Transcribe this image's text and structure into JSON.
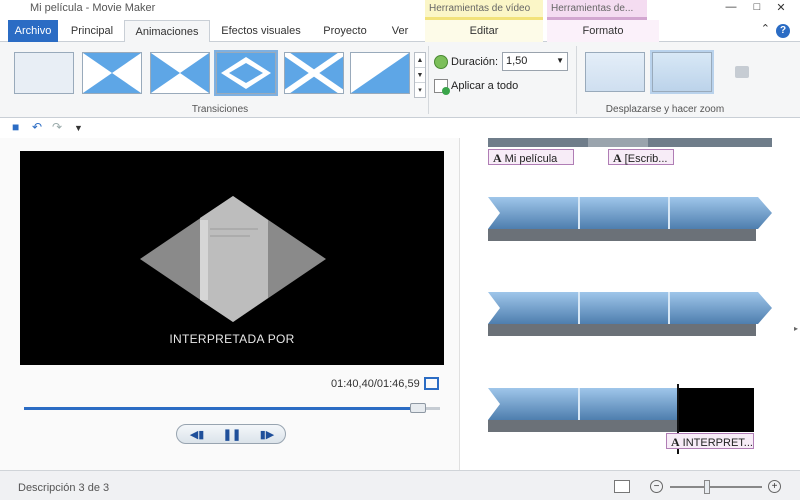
{
  "window": {
    "title": "Mi película - Movie Maker",
    "context_tabs": {
      "video_tools": "Herramientas de vídeo",
      "text_tools": "Herramientas de..."
    },
    "controls": [
      "—",
      "□",
      "✕"
    ]
  },
  "tabs": {
    "file": "Archivo",
    "items": [
      "Principal",
      "Animaciones",
      "Efectos visuales",
      "Proyecto",
      "Ver",
      "Editar",
      "Formato"
    ],
    "active": "Animaciones",
    "help": "?"
  },
  "ribbon": {
    "transitions_group": "Transiciones",
    "duration_label": "Duración:",
    "duration_value": "1,50",
    "apply_all": "Aplicar a todo",
    "pan_zoom_group": "Desplazarse y hacer zoom"
  },
  "preview": {
    "caption": "INTERPRETADA POR",
    "time": "01:40,40/01:46,59",
    "seek_fraction": 0.947
  },
  "storyboard": {
    "text_tags": [
      "Mi película",
      "[Escrib...",
      "INTERPRET..."
    ],
    "text_tag_icon": "A"
  },
  "status": {
    "description": "Descripción 3 de 3"
  },
  "colors": {
    "accent": "#2b6cc4",
    "text_tag_border": "#b07db5"
  }
}
